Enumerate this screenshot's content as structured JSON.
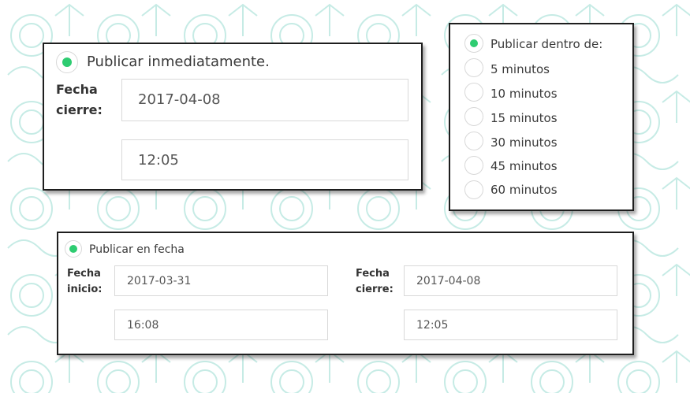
{
  "colors": {
    "accent": "#2ecc71",
    "border": "#1e1e1e",
    "pattern": "#7fd3c6"
  },
  "immediate_card": {
    "option_label": "Publicar inmediatamente.",
    "selected": true,
    "close_label_line1": "Fecha",
    "close_label_line2": "cierre:",
    "close_date": "2017-04-08",
    "close_time": "12:05"
  },
  "delay_card": {
    "header_label": "Publicar dentro de:",
    "selected": true,
    "options": [
      "5 minutos",
      "10 minutos",
      "15 minutos",
      "30 minutos",
      "45 minutos",
      "60 minutos"
    ]
  },
  "date_card": {
    "option_label": "Publicar en fecha",
    "selected": true,
    "start_label_line1": "Fecha",
    "start_label_line2": "inicio:",
    "start_date": "2017-03-31",
    "start_time": "16:08",
    "close_label_line1": "Fecha",
    "close_label_line2": "cierre:",
    "close_date": "2017-04-08",
    "close_time": "12:05"
  }
}
